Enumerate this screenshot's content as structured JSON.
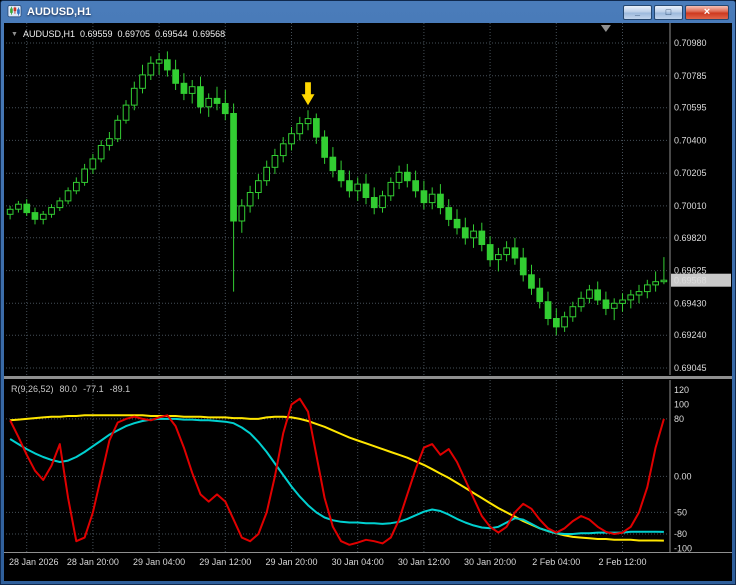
{
  "window": {
    "title": "AUDUSD,H1",
    "controls": {
      "minimize": "_",
      "maximize": "□",
      "close": "×"
    }
  },
  "chart": {
    "info": {
      "collapse_icon": "▼",
      "symbol": "AUDUSD,H1",
      "open": "0.69559",
      "high": "0.69705",
      "low": "0.69544",
      "close": "0.69568"
    },
    "price_axis": [
      "0.70980",
      "0.70785",
      "0.70595",
      "0.70400",
      "0.70205",
      "0.70010",
      "0.69820",
      "0.69625",
      "0.69430",
      "0.69240",
      "0.69045"
    ],
    "current_price": "0.69568",
    "time_axis": [
      "28 Jan 2026",
      "28 Jan 20:00",
      "29 Jan 04:00",
      "29 Jan 12:00",
      "29 Jan 20:00",
      "30 Jan 04:00",
      "30 Jan 12:00",
      "30 Jan 20:00",
      "2 Feb 04:00",
      "2 Feb 12:00"
    ]
  },
  "indicator": {
    "name": "R(9,26,52)",
    "values": [
      "80.0",
      "-77.1",
      "-89.1"
    ],
    "scale": [
      "120",
      "100",
      "80",
      "0.00",
      "-50",
      "-80",
      "-100"
    ],
    "scale_values": [
      120,
      100,
      80,
      0,
      -50,
      -80,
      -100
    ],
    "levels": [
      80,
      0,
      -50,
      -80
    ]
  },
  "colors": {
    "bg": "#000000",
    "candle": "#32CD32",
    "grid": "#454f58",
    "arrow": "#FFD700",
    "price_tag_bg": "#c9c9c9",
    "separator": "#8f8f8f"
  },
  "chart_data": {
    "type": "candlestick",
    "symbol": "AUDUSD",
    "timeframe": "H1",
    "price_ticks": [
      0.7098,
      0.70785,
      0.70595,
      0.704,
      0.70205,
      0.7001,
      0.6982,
      0.69625,
      0.6943,
      0.6924,
      0.69045
    ],
    "current_price": 0.69568,
    "time_label_bars": [
      2,
      10,
      18,
      26,
      34,
      42,
      50,
      58,
      66,
      74
    ],
    "shift_marker_bar": 72,
    "arrow": {
      "bar": 36,
      "price": 0.7058,
      "direction": "down"
    },
    "indicator_range": [
      -105,
      134
    ],
    "candles": [
      [
        0.6996,
        0.7001,
        0.6993,
        0.6999
      ],
      [
        0.6999,
        0.7004,
        0.6997,
        0.7002
      ],
      [
        0.7002,
        0.7005,
        0.6995,
        0.6997
      ],
      [
        0.6997,
        0.7,
        0.699,
        0.6993
      ],
      [
        0.6993,
        0.6998,
        0.699,
        0.6996
      ],
      [
        0.6996,
        0.7002,
        0.6994,
        0.7
      ],
      [
        0.7,
        0.7006,
        0.6998,
        0.7004
      ],
      [
        0.7004,
        0.7012,
        0.7002,
        0.701
      ],
      [
        0.701,
        0.7018,
        0.7008,
        0.7015
      ],
      [
        0.7015,
        0.7026,
        0.7013,
        0.7023
      ],
      [
        0.7023,
        0.7032,
        0.702,
        0.7029
      ],
      [
        0.7029,
        0.704,
        0.7027,
        0.7037
      ],
      [
        0.7037,
        0.7045,
        0.7034,
        0.7041
      ],
      [
        0.7041,
        0.7055,
        0.7039,
        0.7052
      ],
      [
        0.7052,
        0.7064,
        0.705,
        0.7061
      ],
      [
        0.7061,
        0.7075,
        0.7058,
        0.7071
      ],
      [
        0.7071,
        0.7085,
        0.7068,
        0.7079
      ],
      [
        0.7079,
        0.709,
        0.7076,
        0.7086
      ],
      [
        0.7086,
        0.7092,
        0.7079,
        0.7088
      ],
      [
        0.7088,
        0.7093,
        0.7078,
        0.7082
      ],
      [
        0.7082,
        0.7088,
        0.707,
        0.7074
      ],
      [
        0.7074,
        0.708,
        0.7064,
        0.7068
      ],
      [
        0.7068,
        0.7076,
        0.7062,
        0.7072
      ],
      [
        0.7072,
        0.7078,
        0.7056,
        0.706
      ],
      [
        0.706,
        0.7068,
        0.7054,
        0.7065
      ],
      [
        0.7065,
        0.7072,
        0.7058,
        0.7062
      ],
      [
        0.7062,
        0.707,
        0.7052,
        0.7056
      ],
      [
        0.7056,
        0.7062,
        0.695,
        0.6992
      ],
      [
        0.6992,
        0.7005,
        0.6985,
        0.7001
      ],
      [
        0.7001,
        0.7013,
        0.6997,
        0.7009
      ],
      [
        0.7009,
        0.702,
        0.7005,
        0.7016
      ],
      [
        0.7016,
        0.7028,
        0.7013,
        0.7024
      ],
      [
        0.7024,
        0.7035,
        0.702,
        0.7031
      ],
      [
        0.7031,
        0.7042,
        0.7027,
        0.7038
      ],
      [
        0.7038,
        0.7048,
        0.7034,
        0.7044
      ],
      [
        0.7044,
        0.7054,
        0.704,
        0.705
      ],
      [
        0.705,
        0.7058,
        0.7046,
        0.7053
      ],
      [
        0.7053,
        0.7056,
        0.7038,
        0.7042
      ],
      [
        0.7042,
        0.7046,
        0.7026,
        0.703
      ],
      [
        0.703,
        0.7036,
        0.7018,
        0.7022
      ],
      [
        0.7022,
        0.7028,
        0.7012,
        0.7016
      ],
      [
        0.7016,
        0.7022,
        0.7006,
        0.701
      ],
      [
        0.701,
        0.7018,
        0.7004,
        0.7014
      ],
      [
        0.7014,
        0.702,
        0.7002,
        0.7006
      ],
      [
        0.7006,
        0.7012,
        0.6996,
        0.7
      ],
      [
        0.7,
        0.701,
        0.6997,
        0.7007
      ],
      [
        0.7007,
        0.7018,
        0.7004,
        0.7015
      ],
      [
        0.7015,
        0.7025,
        0.7011,
        0.7021
      ],
      [
        0.7021,
        0.7026,
        0.7012,
        0.7016
      ],
      [
        0.7016,
        0.7022,
        0.7006,
        0.701
      ],
      [
        0.701,
        0.7016,
        0.6999,
        0.7003
      ],
      [
        0.7003,
        0.7012,
        0.6999,
        0.7008
      ],
      [
        0.7008,
        0.7014,
        0.6996,
        0.7
      ],
      [
        0.7,
        0.7005,
        0.6989,
        0.6993
      ],
      [
        0.6993,
        0.6999,
        0.6984,
        0.6988
      ],
      [
        0.6988,
        0.6994,
        0.6978,
        0.6982
      ],
      [
        0.6982,
        0.699,
        0.6976,
        0.6986
      ],
      [
        0.6986,
        0.6991,
        0.6974,
        0.6978
      ],
      [
        0.6978,
        0.6983,
        0.6965,
        0.6969
      ],
      [
        0.6969,
        0.6976,
        0.6962,
        0.6972
      ],
      [
        0.6972,
        0.698,
        0.6968,
        0.6976
      ],
      [
        0.6976,
        0.6982,
        0.6966,
        0.697
      ],
      [
        0.697,
        0.6976,
        0.6956,
        0.696
      ],
      [
        0.696,
        0.6966,
        0.6948,
        0.6952
      ],
      [
        0.6952,
        0.6958,
        0.694,
        0.6944
      ],
      [
        0.6944,
        0.695,
        0.693,
        0.6934
      ],
      [
        0.6934,
        0.694,
        0.6924,
        0.6929
      ],
      [
        0.6929,
        0.6938,
        0.6926,
        0.6935
      ],
      [
        0.6935,
        0.6944,
        0.6932,
        0.6941
      ],
      [
        0.6941,
        0.695,
        0.6938,
        0.6946
      ],
      [
        0.6946,
        0.6954,
        0.6943,
        0.6951
      ],
      [
        0.6951,
        0.6956,
        0.6942,
        0.6945
      ],
      [
        0.6945,
        0.695,
        0.6936,
        0.694
      ],
      [
        0.694,
        0.6946,
        0.6933,
        0.6943
      ],
      [
        0.6943,
        0.6949,
        0.6938,
        0.6945
      ],
      [
        0.6945,
        0.6951,
        0.694,
        0.6948
      ],
      [
        0.6948,
        0.6954,
        0.6943,
        0.695
      ],
      [
        0.695,
        0.6957,
        0.6946,
        0.6954
      ],
      [
        0.6954,
        0.6962,
        0.695,
        0.69559
      ],
      [
        0.69559,
        0.69705,
        0.69544,
        0.69568
      ]
    ],
    "series": [
      {
        "name": "r52-slow",
        "color": "#FFE600",
        "values": [
          78,
          79,
          80,
          81,
          82,
          83,
          83,
          84,
          84,
          85,
          85,
          85,
          85,
          85,
          85,
          85,
          85,
          84,
          84,
          84,
          84,
          83,
          83,
          83,
          82,
          82,
          82,
          81,
          81,
          80,
          80,
          82,
          83,
          83,
          82,
          80,
          77,
          73,
          69,
          64,
          59,
          54,
          50,
          46,
          42,
          38,
          34,
          30,
          26,
          21,
          16,
          10,
          4,
          -2,
          -9,
          -16,
          -23,
          -30,
          -37,
          -44,
          -50,
          -56,
          -62,
          -67,
          -72,
          -76,
          -79,
          -82,
          -84,
          -85,
          -86,
          -87,
          -87,
          -88,
          -88,
          -88,
          -89,
          -89,
          -89,
          -89.1
        ]
      },
      {
        "name": "r26-mid",
        "color": "#00D0D0",
        "values": [
          52,
          45,
          38,
          32,
          27,
          23,
          20,
          22,
          27,
          34,
          42,
          50,
          58,
          64,
          70,
          74,
          77,
          79,
          80,
          80,
          80,
          79,
          79,
          78,
          78,
          77,
          76,
          74,
          68,
          60,
          48,
          34,
          18,
          2,
          -14,
          -28,
          -40,
          -50,
          -57,
          -61,
          -63,
          -64,
          -64,
          -65,
          -65,
          -66,
          -65,
          -63,
          -59,
          -54,
          -49,
          -46,
          -48,
          -53,
          -59,
          -64,
          -68,
          -71,
          -72,
          -70,
          -64,
          -58,
          -60,
          -66,
          -72,
          -76,
          -79,
          -80,
          -80,
          -79,
          -79,
          -78,
          -78,
          -78,
          -78,
          -77,
          -77,
          -77,
          -77,
          -77.1
        ]
      },
      {
        "name": "r9-fast",
        "color": "#E00000",
        "values": [
          78,
          55,
          30,
          8,
          -5,
          15,
          45,
          -30,
          -90,
          -85,
          -50,
          0,
          50,
          75,
          80,
          83,
          80,
          78,
          82,
          85,
          70,
          40,
          5,
          -25,
          -35,
          -25,
          -35,
          -60,
          -85,
          -90,
          -80,
          -50,
          0,
          60,
          100,
          108,
          90,
          30,
          -30,
          -70,
          -90,
          -95,
          -92,
          -88,
          -90,
          -93,
          -85,
          -60,
          -25,
          10,
          40,
          45,
          30,
          38,
          20,
          -5,
          -30,
          -55,
          -70,
          -78,
          -70,
          -50,
          -38,
          -45,
          -60,
          -72,
          -78,
          -72,
          -62,
          -55,
          -60,
          -70,
          -77,
          -80,
          -78,
          -70,
          -50,
          -15,
          40,
          80
        ]
      }
    ]
  }
}
